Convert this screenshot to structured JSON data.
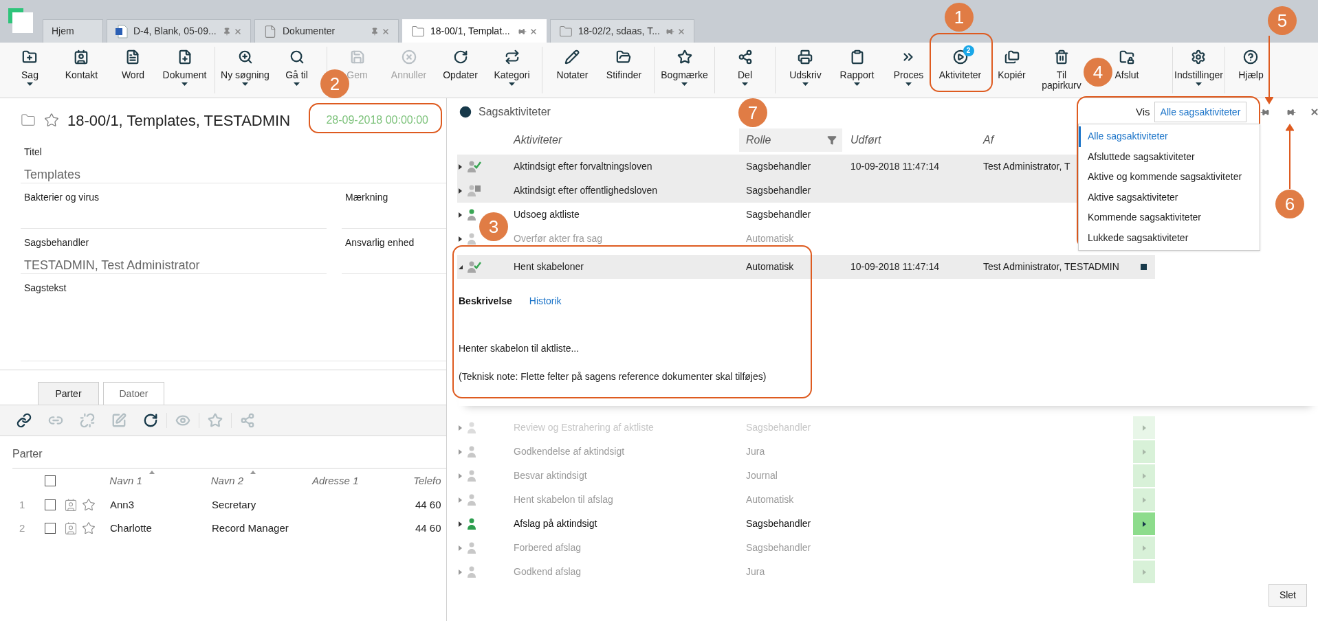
{
  "tabs": [
    {
      "label": "Hjem",
      "kind": "home",
      "selected": false,
      "closable": false
    },
    {
      "label": "D-4, Blank, 05-09...",
      "kind": "word",
      "selected": false,
      "pinned": false,
      "closable": true
    },
    {
      "label": "Dokumenter",
      "kind": "document",
      "selected": false,
      "pinned": false,
      "closable": true
    },
    {
      "label": "18-00/1, Templat...",
      "kind": "folder",
      "selected": true,
      "pinned": true,
      "closable": true
    },
    {
      "label": "18-02/2, sdaas, T...",
      "kind": "folder",
      "selected": false,
      "pinned": true,
      "closable": true
    }
  ],
  "toolbar": {
    "groups": [
      [
        {
          "label": "Sag",
          "dropdown": true,
          "disabled": false
        },
        {
          "label": "Kontakt",
          "dropdown": false,
          "disabled": false
        },
        {
          "label": "Word",
          "dropdown": false,
          "disabled": false
        },
        {
          "label": "Dokument",
          "dropdown": true,
          "disabled": false
        }
      ],
      [
        {
          "label": "Ny søgning",
          "dropdown": true,
          "disabled": false
        },
        {
          "label": "Gå til",
          "dropdown": true,
          "disabled": false
        }
      ],
      [
        {
          "label": "Gem",
          "dropdown": false,
          "disabled": true
        },
        {
          "label": "Annuller",
          "dropdown": false,
          "disabled": true
        },
        {
          "label": "Opdater",
          "dropdown": false,
          "disabled": false
        },
        {
          "label": "Kategori",
          "dropdown": true,
          "disabled": false
        }
      ],
      [
        {
          "label": "Notater",
          "dropdown": false,
          "disabled": false
        },
        {
          "label": "Stifinder",
          "dropdown": false,
          "disabled": false
        }
      ],
      [
        {
          "label": "Bogmærke",
          "dropdown": true,
          "disabled": false
        }
      ],
      [
        {
          "label": "Del",
          "dropdown": true,
          "disabled": false
        }
      ],
      [
        {
          "label": "Udskriv",
          "dropdown": true,
          "disabled": false
        },
        {
          "label": "Rapport",
          "dropdown": true,
          "disabled": false
        },
        {
          "label": "Proces",
          "dropdown": true,
          "disabled": false
        },
        {
          "label": "Aktiviteter",
          "dropdown": false,
          "disabled": false,
          "badge": "2"
        },
        {
          "label": "Kopiér",
          "dropdown": false,
          "disabled": false
        },
        {
          "label": "Til papirkurv",
          "dropdown": false,
          "disabled": false
        },
        {
          "label": "Afslut",
          "dropdown": false,
          "disabled": false
        }
      ],
      [
        {
          "label": "Indstillinger",
          "dropdown": true,
          "disabled": false
        }
      ],
      [
        {
          "label": "Hjælp",
          "dropdown": false,
          "disabled": false
        }
      ]
    ]
  },
  "case": {
    "title": "18-00/1, Templates, TESTADMIN",
    "date": "28-09-2018 00:00:00",
    "fields": [
      [
        {
          "label": "Titel",
          "value": "Templates"
        }
      ],
      [
        {
          "label": "Bakterier og virus"
        },
        {
          "label": "Mærkning"
        }
      ],
      [
        {
          "label": "Sagsbehandler",
          "value": "TESTADMIN, Test Administrator"
        },
        {
          "label": "Ansvarlig enhed"
        }
      ],
      [
        {
          "label": "Sagstekst"
        }
      ]
    ]
  },
  "lower_tabs": [
    {
      "label": "Parter",
      "selected": true
    },
    {
      "label": "Datoer",
      "selected": false
    }
  ],
  "parties_toolbar": [
    {
      "disabled": false
    },
    {
      "disabled": true
    },
    {
      "disabled": true
    },
    {
      "disabled": true
    },
    {
      "disabled": false
    },
    {
      "disabled": true
    },
    {
      "disabled": true
    },
    {
      "disabled": true
    }
  ],
  "parties": {
    "title": "Parter",
    "all_checked": false,
    "columns": [
      {
        "label": "Navn 1",
        "sorted": true
      },
      {
        "label": "Navn 2",
        "sorted": true
      },
      {
        "label": "Adresse 1",
        "sorted": false
      },
      {
        "label": "Telefo",
        "sorted": false
      }
    ],
    "rows": [
      {
        "number": "1",
        "checked": false,
        "name_1": "Ann3",
        "name_2": "Secretary",
        "phone": "44 60"
      },
      {
        "number": "2",
        "checked": false,
        "name_1": "Charlotte",
        "name_2": "Record Manager",
        "phone": "44 60"
      }
    ]
  },
  "activities": {
    "title": "Sagsaktiviteter",
    "view_label": "Vis",
    "view_value": "Alle sagsaktiviteter",
    "view_options": [
      {
        "label": "Alle sagsaktiviteter",
        "selected": true
      },
      {
        "label": "Afsluttede sagsaktiviteter",
        "selected": false
      },
      {
        "label": "Aktive og kommende sagsaktiviteter",
        "selected": false
      },
      {
        "label": "Aktive sagsaktiviteter",
        "selected": false
      },
      {
        "label": "Kommende sagsaktiviteter",
        "selected": false
      },
      {
        "label": "Lukkede sagsaktiviteter",
        "selected": false
      }
    ],
    "columns": [
      {
        "label": "Aktiviteter",
        "filter": false
      },
      {
        "label": "Rolle",
        "filter": true
      },
      {
        "label": "Udført",
        "filter": false
      },
      {
        "label": "Af",
        "filter": false
      }
    ],
    "rows": [
      {
        "name": "Aktindsigt efter forvaltningsloven",
        "role": "Sagsbehandler",
        "done": "10-09-2018 11:47:14",
        "by": "Test Administrator, T",
        "kind": "done",
        "shaded": true,
        "expanded": false
      },
      {
        "name": "Aktindsigt efter offentlighedsloven",
        "role": "Sagsbehandler",
        "kind": "partial",
        "shaded": true,
        "expanded": false
      },
      {
        "name": "Udsoeg aktliste",
        "role": "Sagsbehandler",
        "kind": "current",
        "shaded": false,
        "expanded": false
      },
      {
        "name": "Overfør akter fra sag",
        "role": "Automatisk",
        "kind": "waiting",
        "shaded": false
      },
      {
        "name": "Hent skabeloner",
        "role": "Automatisk",
        "done": "10-09-2018 11:47:14",
        "by": "Test Administrator, TESTADMIN",
        "kind": "done",
        "shaded": true,
        "expanded": true,
        "flagged": true,
        "details": {
          "tabs": [
            {
              "label": "Beskrivelse",
              "selected": true
            },
            {
              "label": "Historik",
              "selected": false
            }
          ],
          "text": [
            "Henter skabelon til aktliste...",
            "(Teknisk note: Flette felter på sagens reference dokumenter skal tilføjes)"
          ]
        }
      }
    ],
    "upcoming": [
      {
        "name": "Review og Estrahering af aktliste",
        "role": "Sagsbehandler",
        "kind": "future"
      },
      {
        "name": "Godkendelse af aktindsigt",
        "role": "Jura",
        "kind": "waiting"
      },
      {
        "name": "Besvar aktindsigt",
        "role": "Journal",
        "kind": "waiting"
      },
      {
        "name": "Hent skabelon til afslag",
        "role": "Automatisk",
        "kind": "waiting"
      },
      {
        "name": "Afslag på aktindsigt",
        "role": "Sagsbehandler",
        "kind": "active"
      },
      {
        "name": "Forbered afslag",
        "role": "Sagsbehandler",
        "kind": "waiting"
      },
      {
        "name": "Godkend afslag",
        "role": "Jura",
        "kind": "waiting"
      }
    ],
    "delete_button": "Slet"
  },
  "callouts": [
    {
      "label": "1",
      "kind": "framed"
    },
    {
      "label": "2",
      "kind": "framed"
    },
    {
      "label": "3",
      "kind": "framed"
    },
    {
      "label": "4",
      "kind": "framed"
    },
    {
      "label": "5",
      "kind": "arrow"
    },
    {
      "label": "6",
      "kind": "arrow"
    },
    {
      "label": "7",
      "kind": "plain"
    }
  ]
}
